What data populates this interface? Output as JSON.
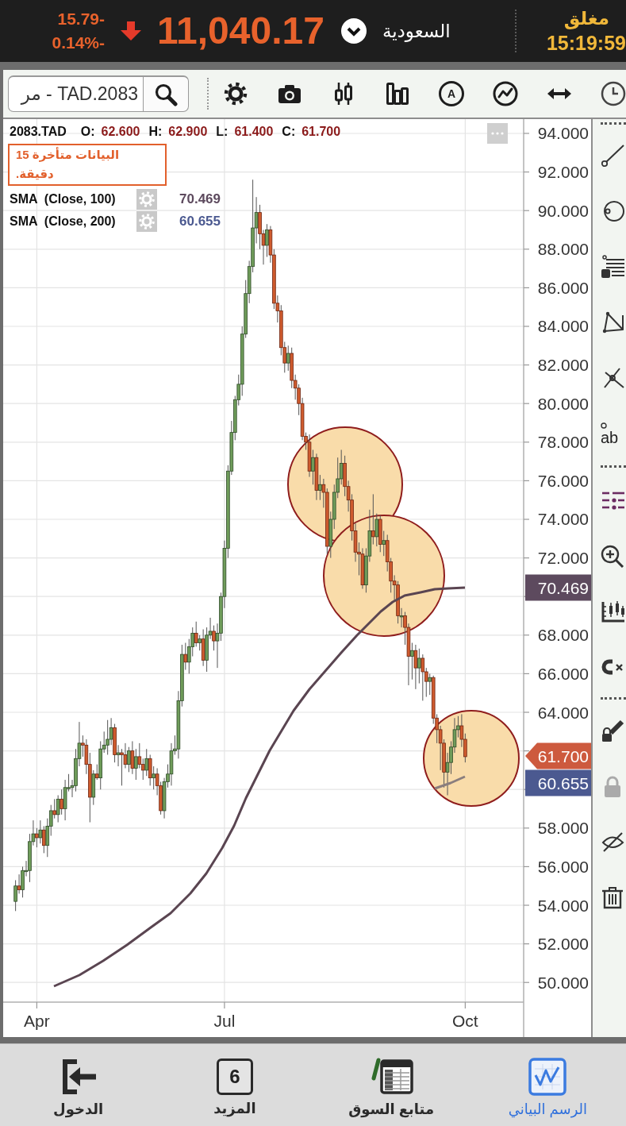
{
  "top_bar": {
    "status": "مغلق",
    "time": "15:19:59",
    "market": "السعودية",
    "index_value": "11,040.17",
    "rising": false,
    "change": "15.79-",
    "change_percent": "0.14%-"
  },
  "toolbar": {
    "search": {
      "value": "2083.TAD - مر"
    },
    "label_tool": "A"
  },
  "chart": {
    "symbol": "2083.TAD",
    "legend_fields": [
      {
        "label": "O:",
        "value": "62.600"
      },
      {
        "label": "H:",
        "value": "62.900"
      },
      {
        "label": "L:",
        "value": "61.400"
      },
      {
        "label": "C:",
        "value": "61.700"
      }
    ],
    "delay_notice": "البيانات متأخرة 15 دقيقة.",
    "indicators": [
      {
        "name": "SMA  (Close, 100)",
        "value": "70.469",
        "color": "#5d4a5e"
      },
      {
        "name": "SMA  (Close, 200)",
        "value": "60.655",
        "color": "#4b5990"
      }
    ],
    "price_tags": [
      {
        "kind": "indicator",
        "value": "70.469",
        "color": "#5d4a5e"
      },
      {
        "kind": "last",
        "value": "61.700",
        "color": "#cd5a3e"
      },
      {
        "kind": "indicator",
        "value": "60.655",
        "color": "#4b5990"
      }
    ],
    "chart_data": {
      "type": "candlestick",
      "grid": true,
      "categories": [
        null,
        null,
        null,
        null,
        null,
        null,
        null,
        null,
        null,
        "Apr",
        null,
        null,
        null,
        null,
        null,
        null,
        null,
        null,
        null,
        null,
        null,
        null,
        null,
        null,
        null,
        null,
        null,
        null,
        null,
        null,
        null,
        null,
        null,
        null,
        null,
        null,
        null,
        null,
        null,
        null,
        null,
        null,
        null,
        null,
        null,
        null,
        null,
        null,
        null,
        null,
        null,
        null,
        null,
        null,
        null,
        null,
        null,
        null,
        null,
        null,
        null,
        null,
        "Jul",
        null,
        null,
        null,
        null,
        null,
        null,
        null,
        null,
        null,
        null,
        null,
        null,
        null,
        null,
        null,
        null,
        null,
        null,
        null,
        null,
        null,
        null,
        null,
        null,
        null,
        null,
        null,
        null,
        null,
        null,
        null,
        null,
        null,
        null,
        null,
        null,
        null,
        null,
        null,
        null,
        null,
        null,
        null,
        null,
        null,
        null,
        null,
        null,
        null,
        null,
        null,
        null,
        null,
        null,
        null,
        null,
        null,
        null,
        null,
        null,
        null,
        null,
        null,
        null,
        null,
        null,
        null,
        "Oct",
        null,
        null,
        null,
        null,
        null,
        null,
        null,
        null,
        null,
        null,
        null,
        null,
        null,
        null,
        null,
        null
      ],
      "ohlc": [
        null,
        null,
        null,
        [
          54.2,
          55.3,
          53.7,
          55.0
        ],
        [
          55.0,
          55.6,
          54.6,
          54.8
        ],
        [
          54.8,
          56.0,
          54.4,
          55.8
        ],
        [
          55.8,
          56.3,
          55.5,
          55.8
        ],
        [
          55.8,
          57.7,
          55.2,
          57.3
        ],
        [
          57.3,
          58.4,
          57.1,
          57.7
        ],
        [
          57.7,
          58.0,
          57.0,
          57.5
        ],
        [
          57.5,
          58.4,
          57.2,
          57.9
        ],
        [
          57.9,
          58.1,
          56.7,
          57.1
        ],
        [
          57.1,
          58.5,
          56.5,
          58.1
        ],
        [
          58.1,
          59.2,
          57.6,
          58.9
        ],
        [
          58.9,
          59.5,
          58.5,
          58.7
        ],
        [
          58.7,
          59.7,
          58.3,
          59.5
        ],
        [
          59.5,
          60.0,
          58.7,
          59.0
        ],
        [
          59.0,
          60.5,
          58.4,
          60.1
        ],
        [
          60.1,
          60.8,
          59.9,
          60.1
        ],
        [
          60.1,
          60.5,
          59.6,
          60.2
        ],
        [
          60.2,
          62.1,
          59.9,
          61.6
        ],
        [
          61.6,
          63.5,
          61.2,
          62.4
        ],
        [
          62.4,
          62.8,
          61.7,
          62.3
        ],
        [
          62.3,
          62.6,
          60.8,
          61.3
        ],
        [
          61.3,
          61.9,
          58.3,
          59.6
        ],
        [
          59.6,
          61.0,
          59.2,
          60.8
        ],
        [
          60.8,
          61.3,
          60.5,
          60.6
        ],
        [
          60.6,
          62.5,
          60.0,
          62.1
        ],
        [
          62.1,
          63.0,
          61.9,
          62.3
        ],
        [
          62.3,
          63.6,
          61.8,
          62.6
        ],
        [
          62.6,
          63.7,
          62.3,
          63.2
        ],
        [
          63.2,
          63.4,
          61.4,
          61.8
        ],
        [
          61.8,
          62.3,
          61.2,
          61.9
        ],
        [
          61.9,
          62.1,
          60.2,
          61.8
        ],
        [
          61.8,
          62.4,
          61.1,
          61.3
        ],
        [
          61.3,
          62.2,
          60.9,
          62.0
        ],
        [
          62.0,
          62.5,
          60.8,
          61.1
        ],
        [
          61.1,
          62.1,
          60.5,
          61.7
        ],
        [
          61.7,
          62.4,
          61.1,
          61.3
        ],
        [
          61.3,
          61.6,
          60.5,
          61.0
        ],
        [
          61.0,
          62.1,
          60.7,
          61.6
        ],
        [
          61.6,
          61.8,
          60.2,
          60.6
        ],
        [
          60.6,
          61.2,
          60.0,
          60.8
        ],
        [
          60.8,
          61.1,
          59.7,
          60.2
        ],
        [
          60.2,
          60.4,
          58.7,
          58.9
        ],
        [
          58.9,
          60.6,
          58.5,
          60.4
        ],
        [
          60.4,
          61.3,
          60.1,
          60.8
        ],
        [
          60.8,
          62.4,
          60.2,
          62.0
        ],
        [
          62.0,
          62.8,
          61.8,
          62.1
        ],
        [
          62.1,
          65.1,
          61.6,
          64.6
        ],
        [
          64.6,
          67.5,
          64.3,
          67.0
        ],
        [
          67.0,
          67.6,
          66.2,
          66.6
        ],
        [
          66.6,
          67.8,
          66.0,
          67.4
        ],
        [
          67.4,
          68.4,
          66.9,
          68.1
        ],
        [
          68.1,
          68.7,
          67.4,
          67.6
        ],
        [
          67.6,
          68.0,
          67.2,
          67.8
        ],
        [
          67.8,
          68.3,
          66.4,
          66.7
        ],
        [
          66.7,
          68.4,
          66.1,
          68.0
        ],
        [
          68.0,
          68.9,
          67.8,
          68.2
        ],
        [
          68.2,
          68.5,
          67.2,
          67.7
        ],
        [
          67.7,
          68.6,
          66.3,
          68.1
        ],
        [
          68.1,
          70.2,
          67.7,
          70.0
        ],
        [
          70.0,
          72.9,
          69.4,
          72.5
        ],
        [
          72.5,
          76.8,
          72.0,
          76.5
        ],
        [
          76.5,
          79.1,
          76.3,
          78.5
        ],
        [
          78.5,
          80.4,
          78.1,
          80.2
        ],
        [
          80.2,
          81.5,
          79.9,
          81.0
        ],
        [
          81.0,
          84.0,
          80.4,
          83.6
        ],
        [
          83.6,
          86.4,
          83.4,
          85.7
        ],
        [
          85.7,
          87.4,
          85.2,
          87.1
        ],
        [
          87.1,
          91.6,
          86.8,
          89.1
        ],
        [
          89.1,
          90.7,
          88.3,
          89.9
        ],
        [
          89.9,
          90.3,
          88.0,
          88.8
        ],
        [
          88.8,
          89.0,
          87.2,
          88.2
        ],
        [
          88.2,
          89.3,
          87.6,
          89.0
        ],
        [
          89.0,
          89.2,
          87.3,
          87.7
        ],
        [
          87.7,
          88.0,
          84.9,
          85.2
        ],
        [
          85.2,
          85.6,
          84.2,
          84.8
        ],
        [
          84.8,
          85.1,
          82.5,
          82.9
        ],
        [
          82.9,
          83.2,
          81.6,
          82.1
        ],
        [
          82.1,
          83.0,
          81.7,
          82.6
        ],
        [
          82.6,
          82.9,
          80.8,
          81.2
        ],
        [
          81.2,
          81.5,
          80.2,
          80.8
        ],
        [
          80.8,
          81.0,
          79.4,
          80.0
        ],
        [
          80.0,
          80.3,
          78.1,
          78.3
        ],
        [
          78.3,
          78.5,
          77.6,
          78.0
        ],
        [
          78.0,
          78.4,
          76.2,
          76.5
        ],
        [
          76.5,
          77.6,
          75.8,
          77.2
        ],
        [
          77.2,
          77.4,
          75.0,
          75.5
        ],
        [
          75.5,
          76.3,
          75.0,
          75.8
        ],
        [
          75.8,
          76.1,
          74.6,
          75.4
        ],
        [
          75.4,
          75.6,
          72.2,
          72.6
        ],
        [
          72.6,
          74.4,
          72.0,
          74.0
        ],
        [
          74.0,
          75.8,
          73.5,
          75.4
        ],
        [
          75.4,
          77.2,
          75.1,
          76.1
        ],
        [
          76.1,
          77.6,
          75.8,
          76.9
        ],
        [
          76.9,
          77.3,
          75.2,
          75.7
        ],
        [
          75.7,
          76.0,
          74.4,
          75.0
        ],
        [
          75.0,
          75.3,
          72.9,
          73.4
        ],
        [
          73.4,
          73.8,
          71.8,
          72.3
        ],
        [
          72.3,
          72.8,
          71.1,
          72.2
        ],
        [
          72.2,
          72.5,
          70.4,
          70.6
        ],
        [
          70.6,
          72.5,
          70.2,
          72.1
        ],
        [
          72.1,
          74.5,
          71.8,
          73.4
        ],
        [
          73.4,
          75.3,
          72.7,
          73.1
        ],
        [
          73.1,
          74.3,
          72.6,
          74.0
        ],
        [
          74.0,
          74.2,
          72.3,
          72.7
        ],
        [
          72.7,
          73.4,
          72.1,
          72.9
        ],
        [
          72.9,
          73.2,
          71.3,
          71.8
        ],
        [
          71.8,
          72.0,
          70.2,
          70.8
        ],
        [
          70.8,
          71.1,
          69.8,
          70.6
        ],
        [
          70.6,
          70.8,
          68.6,
          69.0
        ],
        [
          69.0,
          69.4,
          68.4,
          69.0
        ],
        [
          69.0,
          69.2,
          67.5,
          68.4
        ],
        [
          68.4,
          68.6,
          65.4,
          66.9
        ],
        [
          66.9,
          67.6,
          65.7,
          67.2
        ],
        [
          67.2,
          67.5,
          65.2,
          66.3
        ],
        [
          66.3,
          67.3,
          65.5,
          66.8
        ],
        [
          66.8,
          67.0,
          64.6,
          66.1
        ],
        [
          66.1,
          66.3,
          64.8,
          65.6
        ],
        [
          65.6,
          66.0,
          64.9,
          65.8
        ],
        [
          65.8,
          65.9,
          63.4,
          63.7
        ],
        [
          63.7,
          63.9,
          62.4,
          63.1
        ],
        [
          63.1,
          63.3,
          61.0,
          62.4
        ],
        [
          62.4,
          62.6,
          60.1,
          60.9
        ],
        [
          60.9,
          61.9,
          59.7,
          61.4
        ],
        [
          61.4,
          62.5,
          60.8,
          62.2
        ],
        [
          62.2,
          63.7,
          61.9,
          63.1
        ],
        [
          63.1,
          63.8,
          62.7,
          63.3
        ],
        [
          63.3,
          63.9,
          62.2,
          62.6
        ],
        [
          62.6,
          62.9,
          61.4,
          61.7
        ],
        null,
        null,
        null,
        null,
        null,
        null,
        null,
        null,
        null,
        null,
        null,
        null,
        null,
        null,
        null,
        null
      ],
      "ylim": [
        48.98,
        94.74
      ],
      "yticks": [
        {
          "value": 94,
          "label": "94.000"
        },
        {
          "value": 92,
          "label": "92.000"
        },
        {
          "value": 90,
          "label": "90.000"
        },
        {
          "value": 88,
          "label": "88.000"
        },
        {
          "value": 86,
          "label": "86.000"
        },
        {
          "value": 84,
          "label": "84.000"
        },
        {
          "value": 82,
          "label": "82.000"
        },
        {
          "value": 80,
          "label": "80.000"
        },
        {
          "value": 78,
          "label": "78.000"
        },
        {
          "value": 76,
          "label": "76.000"
        },
        {
          "value": 74,
          "label": "74.000"
        },
        {
          "value": 72,
          "label": "72.000"
        },
        {
          "value": 68,
          "label": "68.000"
        },
        {
          "value": 66,
          "label": "66.000"
        },
        {
          "value": 64,
          "label": "64.000"
        },
        {
          "value": 58,
          "label": "58.000"
        },
        {
          "value": 56,
          "label": "56.000"
        },
        {
          "value": 54,
          "label": "54.000"
        },
        {
          "value": 52,
          "label": "52.000"
        },
        {
          "value": 50,
          "label": "50.000"
        }
      ]
    }
  },
  "drawing_toolbar": {
    "text_tool": "ab"
  },
  "bottom_nav": [
    {
      "kind": "chart",
      "label": "الرسم البياني",
      "selected": true
    },
    {
      "kind": "watchlist",
      "label": "متابع السوق",
      "selected": false
    },
    {
      "kind": "more",
      "label": "المزيد",
      "count": "6",
      "selected": false
    },
    {
      "kind": "login",
      "label": "الدخول",
      "selected": false
    }
  ]
}
